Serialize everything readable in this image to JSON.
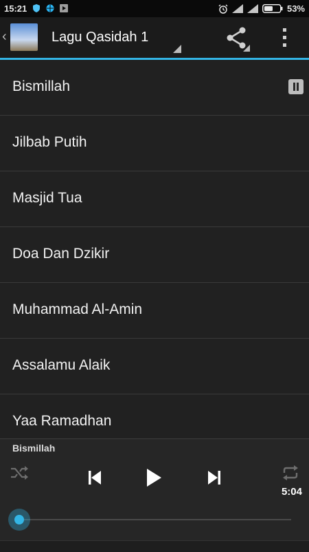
{
  "status_bar": {
    "time": "15:21",
    "battery": "53%",
    "icons": [
      "shield-icon",
      "globe-icon",
      "play-store-icon",
      "alarm-icon",
      "signal-icon",
      "signal-icon",
      "battery-icon"
    ]
  },
  "action_bar": {
    "title": "Lagu Qasidah 1",
    "icons": [
      "back-chevron-icon",
      "app-icon",
      "share-icon",
      "overflow-menu-icon"
    ],
    "accent": "#33b5e5"
  },
  "playlist": {
    "items": [
      {
        "label": "Bismillah",
        "playing": true
      },
      {
        "label": "Jilbab Putih"
      },
      {
        "label": "Masjid Tua"
      },
      {
        "label": "Doa Dan Dzikir"
      },
      {
        "label": "Muhammad Al-Amin"
      },
      {
        "label": "Assalamu Alaik"
      },
      {
        "label": "Yaa Ramadhan"
      }
    ]
  },
  "player": {
    "now_playing": "Bismillah",
    "duration": "5:04",
    "progress": 0.0,
    "icons": [
      "shuffle-icon",
      "previous-icon",
      "play-icon",
      "next-icon",
      "repeat-icon"
    ]
  }
}
